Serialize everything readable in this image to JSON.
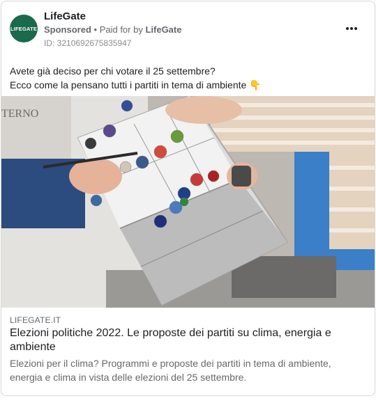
{
  "post": {
    "page_name": "LifeGate",
    "avatar_text": "LIFEGATE",
    "sponsored": "Sponsored",
    "separator": " • ",
    "paid_for": "Paid for by ",
    "paid_by": "LifeGate",
    "ad_id": "ID: 3210692675835947",
    "more_icon": "more-horizontal-icon",
    "text_line1": "Avete già deciso per chi votare il 25 settembre?",
    "text_line2": "Ecco come la pensano tutti i partiti in tema di ambiente 👇"
  },
  "link": {
    "domain": "LIFEGATE.IT",
    "title": "Elezioni politiche 2022. Le proposte dei partiti su clima, energia e ambiente",
    "description": "Elezioni per il clima? Programmi e proposte dei partiti in tema di ambiente, energia e clima in vista delle elezioni del 25 settembre."
  },
  "colors": {
    "avatar_bg": "#1a6a4b",
    "meta_text": "#65676b"
  }
}
